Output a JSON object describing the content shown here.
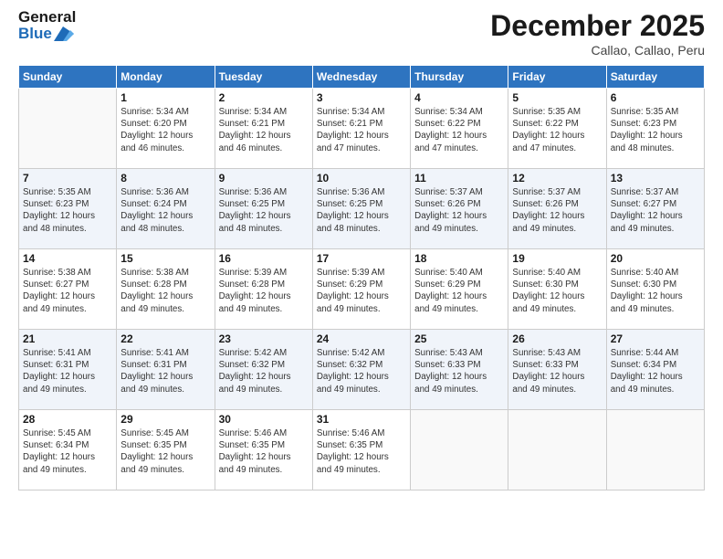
{
  "header": {
    "logo_general": "General",
    "logo_blue": "Blue",
    "month_title": "December 2025",
    "location": "Callao, Callao, Peru"
  },
  "days_of_week": [
    "Sunday",
    "Monday",
    "Tuesday",
    "Wednesday",
    "Thursday",
    "Friday",
    "Saturday"
  ],
  "weeks": [
    [
      {
        "day": "",
        "sunrise": "",
        "sunset": "",
        "daylight": ""
      },
      {
        "day": "1",
        "sunrise": "Sunrise: 5:34 AM",
        "sunset": "Sunset: 6:20 PM",
        "daylight": "Daylight: 12 hours and 46 minutes."
      },
      {
        "day": "2",
        "sunrise": "Sunrise: 5:34 AM",
        "sunset": "Sunset: 6:21 PM",
        "daylight": "Daylight: 12 hours and 46 minutes."
      },
      {
        "day": "3",
        "sunrise": "Sunrise: 5:34 AM",
        "sunset": "Sunset: 6:21 PM",
        "daylight": "Daylight: 12 hours and 47 minutes."
      },
      {
        "day": "4",
        "sunrise": "Sunrise: 5:34 AM",
        "sunset": "Sunset: 6:22 PM",
        "daylight": "Daylight: 12 hours and 47 minutes."
      },
      {
        "day": "5",
        "sunrise": "Sunrise: 5:35 AM",
        "sunset": "Sunset: 6:22 PM",
        "daylight": "Daylight: 12 hours and 47 minutes."
      },
      {
        "day": "6",
        "sunrise": "Sunrise: 5:35 AM",
        "sunset": "Sunset: 6:23 PM",
        "daylight": "Daylight: 12 hours and 48 minutes."
      }
    ],
    [
      {
        "day": "7",
        "sunrise": "Sunrise: 5:35 AM",
        "sunset": "Sunset: 6:23 PM",
        "daylight": "Daylight: 12 hours and 48 minutes."
      },
      {
        "day": "8",
        "sunrise": "Sunrise: 5:36 AM",
        "sunset": "Sunset: 6:24 PM",
        "daylight": "Daylight: 12 hours and 48 minutes."
      },
      {
        "day": "9",
        "sunrise": "Sunrise: 5:36 AM",
        "sunset": "Sunset: 6:25 PM",
        "daylight": "Daylight: 12 hours and 48 minutes."
      },
      {
        "day": "10",
        "sunrise": "Sunrise: 5:36 AM",
        "sunset": "Sunset: 6:25 PM",
        "daylight": "Daylight: 12 hours and 48 minutes."
      },
      {
        "day": "11",
        "sunrise": "Sunrise: 5:37 AM",
        "sunset": "Sunset: 6:26 PM",
        "daylight": "Daylight: 12 hours and 49 minutes."
      },
      {
        "day": "12",
        "sunrise": "Sunrise: 5:37 AM",
        "sunset": "Sunset: 6:26 PM",
        "daylight": "Daylight: 12 hours and 49 minutes."
      },
      {
        "day": "13",
        "sunrise": "Sunrise: 5:37 AM",
        "sunset": "Sunset: 6:27 PM",
        "daylight": "Daylight: 12 hours and 49 minutes."
      }
    ],
    [
      {
        "day": "14",
        "sunrise": "Sunrise: 5:38 AM",
        "sunset": "Sunset: 6:27 PM",
        "daylight": "Daylight: 12 hours and 49 minutes."
      },
      {
        "day": "15",
        "sunrise": "Sunrise: 5:38 AM",
        "sunset": "Sunset: 6:28 PM",
        "daylight": "Daylight: 12 hours and 49 minutes."
      },
      {
        "day": "16",
        "sunrise": "Sunrise: 5:39 AM",
        "sunset": "Sunset: 6:28 PM",
        "daylight": "Daylight: 12 hours and 49 minutes."
      },
      {
        "day": "17",
        "sunrise": "Sunrise: 5:39 AM",
        "sunset": "Sunset: 6:29 PM",
        "daylight": "Daylight: 12 hours and 49 minutes."
      },
      {
        "day": "18",
        "sunrise": "Sunrise: 5:40 AM",
        "sunset": "Sunset: 6:29 PM",
        "daylight": "Daylight: 12 hours and 49 minutes."
      },
      {
        "day": "19",
        "sunrise": "Sunrise: 5:40 AM",
        "sunset": "Sunset: 6:30 PM",
        "daylight": "Daylight: 12 hours and 49 minutes."
      },
      {
        "day": "20",
        "sunrise": "Sunrise: 5:40 AM",
        "sunset": "Sunset: 6:30 PM",
        "daylight": "Daylight: 12 hours and 49 minutes."
      }
    ],
    [
      {
        "day": "21",
        "sunrise": "Sunrise: 5:41 AM",
        "sunset": "Sunset: 6:31 PM",
        "daylight": "Daylight: 12 hours and 49 minutes."
      },
      {
        "day": "22",
        "sunrise": "Sunrise: 5:41 AM",
        "sunset": "Sunset: 6:31 PM",
        "daylight": "Daylight: 12 hours and 49 minutes."
      },
      {
        "day": "23",
        "sunrise": "Sunrise: 5:42 AM",
        "sunset": "Sunset: 6:32 PM",
        "daylight": "Daylight: 12 hours and 49 minutes."
      },
      {
        "day": "24",
        "sunrise": "Sunrise: 5:42 AM",
        "sunset": "Sunset: 6:32 PM",
        "daylight": "Daylight: 12 hours and 49 minutes."
      },
      {
        "day": "25",
        "sunrise": "Sunrise: 5:43 AM",
        "sunset": "Sunset: 6:33 PM",
        "daylight": "Daylight: 12 hours and 49 minutes."
      },
      {
        "day": "26",
        "sunrise": "Sunrise: 5:43 AM",
        "sunset": "Sunset: 6:33 PM",
        "daylight": "Daylight: 12 hours and 49 minutes."
      },
      {
        "day": "27",
        "sunrise": "Sunrise: 5:44 AM",
        "sunset": "Sunset: 6:34 PM",
        "daylight": "Daylight: 12 hours and 49 minutes."
      }
    ],
    [
      {
        "day": "28",
        "sunrise": "Sunrise: 5:45 AM",
        "sunset": "Sunset: 6:34 PM",
        "daylight": "Daylight: 12 hours and 49 minutes."
      },
      {
        "day": "29",
        "sunrise": "Sunrise: 5:45 AM",
        "sunset": "Sunset: 6:35 PM",
        "daylight": "Daylight: 12 hours and 49 minutes."
      },
      {
        "day": "30",
        "sunrise": "Sunrise: 5:46 AM",
        "sunset": "Sunset: 6:35 PM",
        "daylight": "Daylight: 12 hours and 49 minutes."
      },
      {
        "day": "31",
        "sunrise": "Sunrise: 5:46 AM",
        "sunset": "Sunset: 6:35 PM",
        "daylight": "Daylight: 12 hours and 49 minutes."
      },
      {
        "day": "",
        "sunrise": "",
        "sunset": "",
        "daylight": ""
      },
      {
        "day": "",
        "sunrise": "",
        "sunset": "",
        "daylight": ""
      },
      {
        "day": "",
        "sunrise": "",
        "sunset": "",
        "daylight": ""
      }
    ]
  ]
}
